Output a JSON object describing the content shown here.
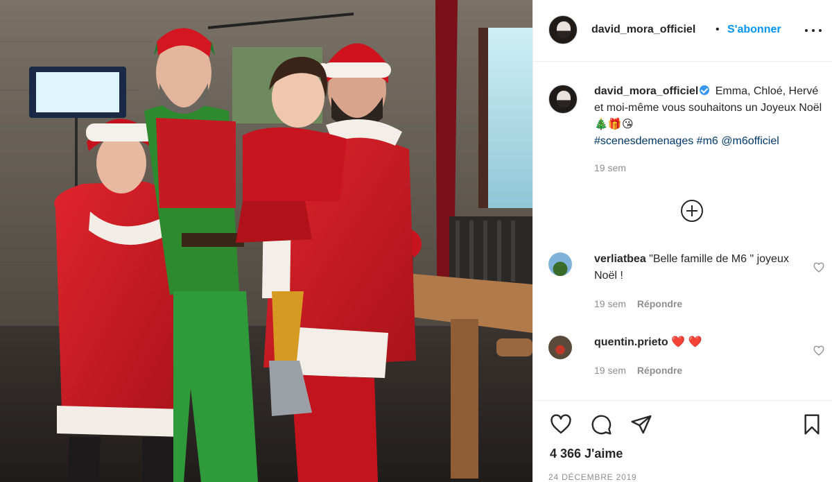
{
  "post": {
    "author": "david_mora_officiel",
    "follow_label": "S'abonner",
    "more_label": "More options"
  },
  "caption": {
    "username": "david_mora_officiel",
    "text": "Emma, Chloé, Hervé et moi-même vous souhaitons un Joyeux Noël",
    "emojis": "🎄🎁😘",
    "hashtag1": "#scenesdemenages",
    "hashtag2": "#m6",
    "mention": "@m6officiel",
    "time": "19 sem"
  },
  "comments": [
    {
      "username": "verliatbea",
      "text": "\"Belle famille de M6 \" joyeux Noël !",
      "time": "19 sem",
      "reply_label": "Répondre"
    },
    {
      "username": "quentin.prieto",
      "text": "❤️ ❤️",
      "time": "19 sem",
      "reply_label": "Répondre"
    }
  ],
  "engagement": {
    "likes": "4 366 J'aime",
    "date": "24 DÉCEMBRE 2019"
  },
  "icons": {
    "like": "heart-icon",
    "comment": "comment-icon",
    "share": "share-icon",
    "save": "bookmark-icon",
    "load_more": "plus-circle-icon"
  },
  "colors": {
    "link": "#0095f6",
    "tag": "#00376b",
    "muted": "#8e8e8e",
    "text": "#262626"
  }
}
